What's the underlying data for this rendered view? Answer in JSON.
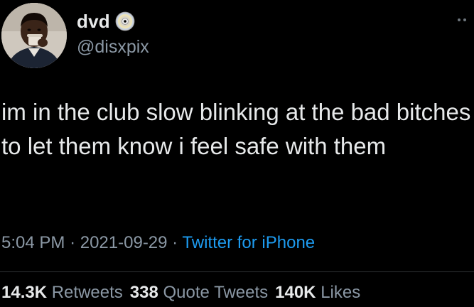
{
  "tweet": {
    "display_name": "dvd",
    "handle": "@disxpix",
    "verified_icon": "cd-disc-icon",
    "text": "im in the club slow blinking at the bad bitches to let them know i feel safe with them",
    "time": "5:04 PM",
    "date": "2021-09-29",
    "separator": "·",
    "source": "Twitter for iPhone",
    "stats": [
      {
        "count": "14.3K",
        "label": "Retweets"
      },
      {
        "count": "338",
        "label": "Quote Tweets"
      },
      {
        "count": "140K",
        "label": "Likes"
      }
    ]
  },
  "colors": {
    "background": "#000000",
    "primary_text": "#e7e9ea",
    "secondary_text": "#8b98a5",
    "link": "#1d9bf0",
    "divider": "#2f3336"
  }
}
